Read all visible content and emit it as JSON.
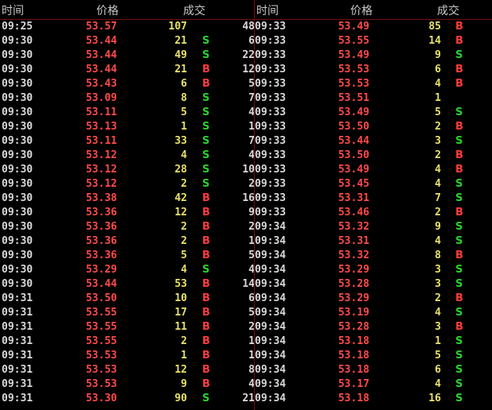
{
  "headers": {
    "time": "时间",
    "price": "价格",
    "volume": "成交"
  },
  "colors": {
    "background": "#000000",
    "price": "#ff4a4a",
    "volume": "#e8e26a",
    "buy": "#ff3c3c",
    "sell": "#2ad12a",
    "divider": "#7a0d0d"
  },
  "left_trades": [
    {
      "time": "09:25",
      "price": "53.57",
      "volume": "107",
      "side": "",
      "overflow": "48"
    },
    {
      "time": "09:30",
      "price": "53.44",
      "volume": "21",
      "side": "S",
      "overflow": "6"
    },
    {
      "time": "09:30",
      "price": "53.44",
      "volume": "49",
      "side": "S",
      "overflow": "22"
    },
    {
      "time": "09:30",
      "price": "53.44",
      "volume": "21",
      "side": "B",
      "overflow": "12"
    },
    {
      "time": "09:30",
      "price": "53.43",
      "volume": "6",
      "side": "B",
      "overflow": "5"
    },
    {
      "time": "09:30",
      "price": "53.09",
      "volume": "8",
      "side": "S",
      "overflow": "7"
    },
    {
      "time": "09:30",
      "price": "53.11",
      "volume": "5",
      "side": "S",
      "overflow": "4"
    },
    {
      "time": "09:30",
      "price": "53.13",
      "volume": "1",
      "side": "S",
      "overflow": "1"
    },
    {
      "time": "09:30",
      "price": "53.11",
      "volume": "33",
      "side": "S",
      "overflow": "7"
    },
    {
      "time": "09:30",
      "price": "53.12",
      "volume": "4",
      "side": "S",
      "overflow": "4"
    },
    {
      "time": "09:30",
      "price": "53.12",
      "volume": "28",
      "side": "S",
      "overflow": "10"
    },
    {
      "time": "09:30",
      "price": "53.12",
      "volume": "2",
      "side": "S",
      "overflow": "2"
    },
    {
      "time": "09:30",
      "price": "53.38",
      "volume": "42",
      "side": "B",
      "overflow": "16"
    },
    {
      "time": "09:30",
      "price": "53.36",
      "volume": "12",
      "side": "B",
      "overflow": "9"
    },
    {
      "time": "09:30",
      "price": "53.36",
      "volume": "2",
      "side": "B",
      "overflow": "2"
    },
    {
      "time": "09:30",
      "price": "53.36",
      "volume": "2",
      "side": "B",
      "overflow": "1"
    },
    {
      "time": "09:30",
      "price": "53.36",
      "volume": "5",
      "side": "B",
      "overflow": "5"
    },
    {
      "time": "09:30",
      "price": "53.29",
      "volume": "4",
      "side": "S",
      "overflow": "4"
    },
    {
      "time": "09:30",
      "price": "53.44",
      "volume": "53",
      "side": "B",
      "overflow": "14"
    },
    {
      "time": "09:31",
      "price": "53.50",
      "volume": "10",
      "side": "B",
      "overflow": "6"
    },
    {
      "time": "09:31",
      "price": "53.55",
      "volume": "17",
      "side": "B",
      "overflow": "5"
    },
    {
      "time": "09:31",
      "price": "53.55",
      "volume": "11",
      "side": "B",
      "overflow": "2"
    },
    {
      "time": "09:31",
      "price": "53.55",
      "volume": "2",
      "side": "B",
      "overflow": "1"
    },
    {
      "time": "09:31",
      "price": "53.53",
      "volume": "1",
      "side": "B",
      "overflow": "1"
    },
    {
      "time": "09:31",
      "price": "53.53",
      "volume": "12",
      "side": "B",
      "overflow": "8"
    },
    {
      "time": "09:31",
      "price": "53.53",
      "volume": "9",
      "side": "B",
      "overflow": "4"
    },
    {
      "time": "09:31",
      "price": "53.30",
      "volume": "90",
      "side": "S",
      "overflow": "21"
    }
  ],
  "right_trades": [
    {
      "time": "09:33",
      "price": "53.49",
      "volume": "85",
      "side": "B"
    },
    {
      "time": "09:33",
      "price": "53.55",
      "volume": "14",
      "side": "B"
    },
    {
      "time": "09:33",
      "price": "53.49",
      "volume": "9",
      "side": "S"
    },
    {
      "time": "09:33",
      "price": "53.53",
      "volume": "6",
      "side": "B"
    },
    {
      "time": "09:33",
      "price": "53.53",
      "volume": "4",
      "side": "B"
    },
    {
      "time": "09:33",
      "price": "53.51",
      "volume": "1",
      "side": ""
    },
    {
      "time": "09:33",
      "price": "53.49",
      "volume": "5",
      "side": "S"
    },
    {
      "time": "09:33",
      "price": "53.50",
      "volume": "2",
      "side": "B"
    },
    {
      "time": "09:33",
      "price": "53.44",
      "volume": "3",
      "side": "S"
    },
    {
      "time": "09:33",
      "price": "53.50",
      "volume": "2",
      "side": "B"
    },
    {
      "time": "09:33",
      "price": "53.49",
      "volume": "4",
      "side": "B"
    },
    {
      "time": "09:33",
      "price": "53.45",
      "volume": "4",
      "side": "S"
    },
    {
      "time": "09:33",
      "price": "53.31",
      "volume": "7",
      "side": "S"
    },
    {
      "time": "09:33",
      "price": "53.46",
      "volume": "2",
      "side": "B"
    },
    {
      "time": "09:34",
      "price": "53.32",
      "volume": "9",
      "side": "S"
    },
    {
      "time": "09:34",
      "price": "53.31",
      "volume": "4",
      "side": "S"
    },
    {
      "time": "09:34",
      "price": "53.32",
      "volume": "8",
      "side": "B"
    },
    {
      "time": "09:34",
      "price": "53.29",
      "volume": "3",
      "side": "S"
    },
    {
      "time": "09:34",
      "price": "53.28",
      "volume": "3",
      "side": "S"
    },
    {
      "time": "09:34",
      "price": "53.29",
      "volume": "2",
      "side": "B"
    },
    {
      "time": "09:34",
      "price": "53.19",
      "volume": "4",
      "side": "S"
    },
    {
      "time": "09:34",
      "price": "53.28",
      "volume": "3",
      "side": "B"
    },
    {
      "time": "09:34",
      "price": "53.18",
      "volume": "1",
      "side": "S"
    },
    {
      "time": "09:34",
      "price": "53.18",
      "volume": "5",
      "side": "S"
    },
    {
      "time": "09:34",
      "price": "53.18",
      "volume": "6",
      "side": "S"
    },
    {
      "time": "09:34",
      "price": "53.17",
      "volume": "4",
      "side": "S"
    },
    {
      "time": "09:34",
      "price": "53.18",
      "volume": "16",
      "side": "S"
    }
  ]
}
